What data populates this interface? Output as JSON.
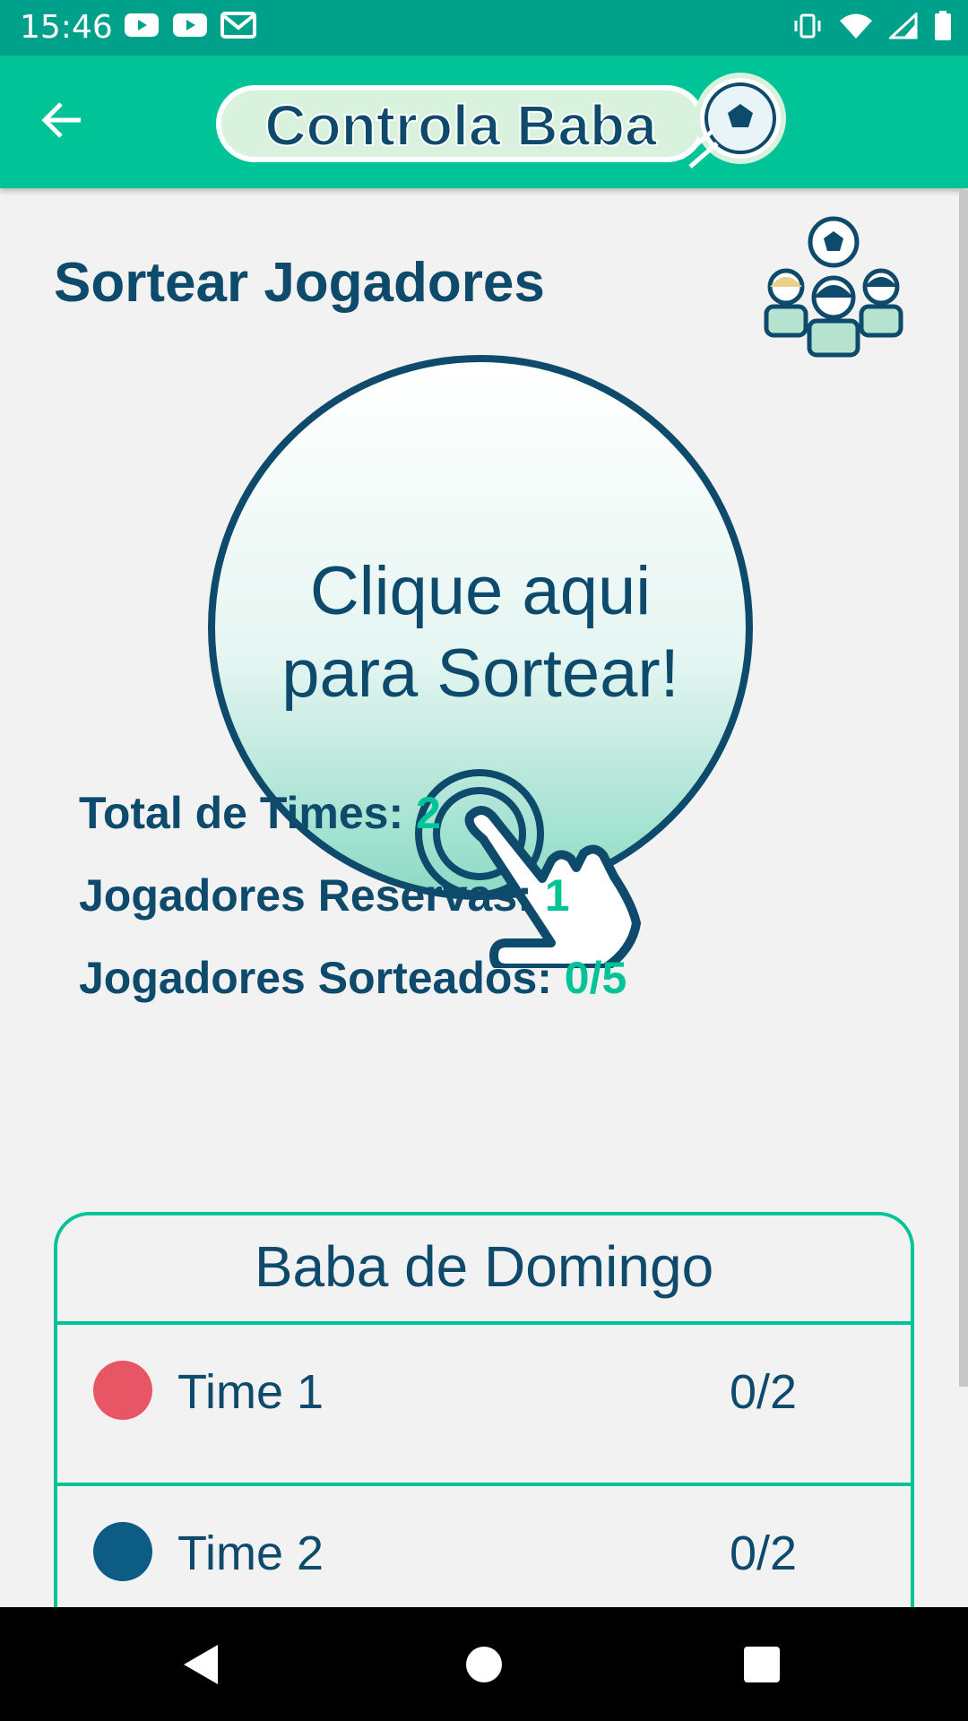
{
  "status_bar": {
    "time": "15:46"
  },
  "app_bar": {
    "title": "Controla Baba"
  },
  "page": {
    "title": "Sortear Jogadores"
  },
  "draw_button": {
    "line1": "Clique aqui",
    "line2": "para Sortear!"
  },
  "stats": {
    "total_times_label": "Total de Times: ",
    "total_times_value": "2",
    "reservas_label": "Jogadores Reservas: ",
    "reservas_value": "1",
    "sorteados_label": "Jogadores Sorteados: ",
    "sorteados_value": "0/5"
  },
  "group": {
    "name": "Baba de Domingo",
    "teams": [
      {
        "name": "Time 1",
        "count": "0/2",
        "color": "#e85565"
      },
      {
        "name": "Time 2",
        "count": "0/2",
        "color": "#0d5c86"
      }
    ]
  },
  "colors": {
    "primary": "#00c398",
    "primary_dark": "#00a18a",
    "text_dark": "#0d4a6b"
  },
  "icons": [
    "youtube-icon",
    "youtube-icon",
    "gmail-icon",
    "vibrate-icon",
    "wifi-icon",
    "signal-icon",
    "battery-icon",
    "back-arrow-icon",
    "soccer-ball-icon",
    "players-icon",
    "tap-hand-icon",
    "nav-back-icon",
    "nav-home-icon",
    "nav-recents-icon"
  ]
}
